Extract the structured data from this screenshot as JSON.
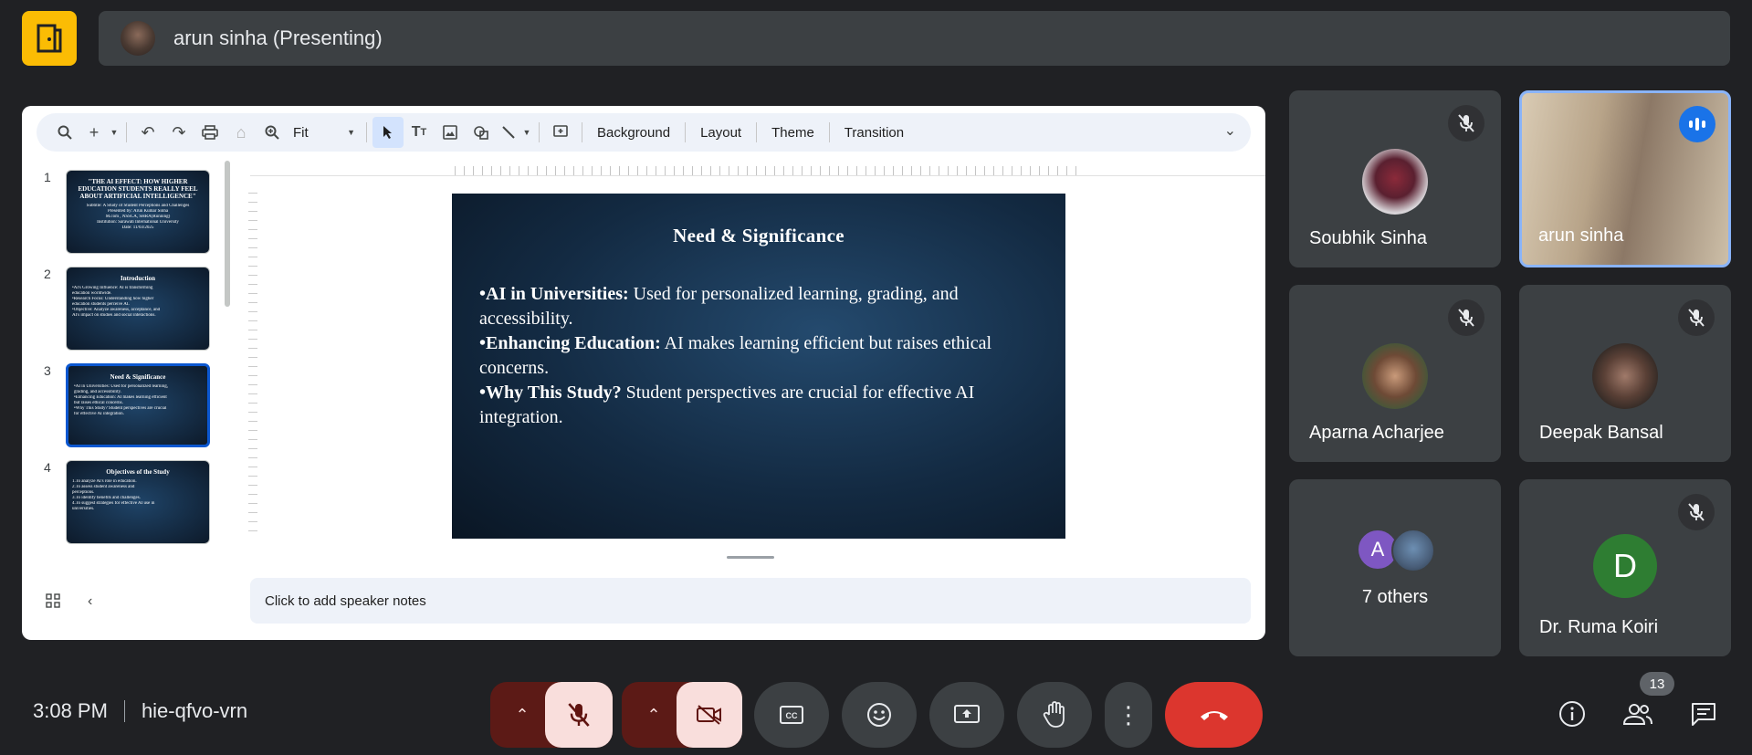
{
  "top": {
    "presenter_label": "arun sinha (Presenting)"
  },
  "toolbar": {
    "zoom_value": "Fit",
    "background_label": "Background",
    "layout_label": "Layout",
    "theme_label": "Theme",
    "transition_label": "Transition"
  },
  "filmstrip": {
    "slides": [
      {
        "number": "1",
        "title": "\"THE AI EFFECT: HOW HIGHER EDUCATION STUDENTS REALLY FEEL ABOUT ARTIFICIAL INTELLIGENCE\"",
        "lines": [
          "Subtitle: A Study of Student Perceptions and Challenges",
          "Presented by: Arun Kumar Sinha",
          "M.com , NSSCA, SHRA(Running)",
          "Institution: Sarawati International University",
          "Date: 11/03/2025"
        ]
      },
      {
        "number": "2",
        "title": "Introduction",
        "lines": [
          "•AI's Growing Influence: AI is transforming",
          "education worldwide.",
          "•Research Focus: Understanding how higher",
          "education students perceive AI.",
          "•Objective: Analyze awareness, acceptance, and",
          "AI's impact on studies and social interactions."
        ]
      },
      {
        "number": "3",
        "title": "Need & Significance",
        "lines": [
          "•AI in Universities: Used for personalized learning,",
          "grading, and accessibility.",
          "•Enhancing Education: AI makes learning efficient",
          "but raises ethical concerns.",
          "•Why This Study? Student perspectives are crucial",
          "for effective AI integration."
        ]
      },
      {
        "number": "4",
        "title": "Objectives of the Study",
        "lines": [
          "1.To analyze AI's role in education.",
          "2.To assess student awareness and",
          "perceptions.",
          "3.To identify benefits and challenges.",
          "4.To suggest strategies for effective AI use in",
          "universities."
        ]
      }
    ]
  },
  "slide": {
    "title": "Need & Significance",
    "bullets": [
      {
        "bold": "•AI in Universities:",
        "text": " Used for personalized learning, grading, and accessibility."
      },
      {
        "bold": "•Enhancing Education:",
        "text": " AI makes learning efficient but raises ethical concerns."
      },
      {
        "bold": "•Why This Study?",
        "text": " Student perspectives are crucial for effective AI integration."
      }
    ]
  },
  "notes": {
    "placeholder": "Click to add speaker notes"
  },
  "participants": {
    "soubhik": "Soubhik Sinha",
    "arun": "arun sinha",
    "aparna": "Aparna Acharjee",
    "deepak": "Deepak Bansal",
    "others_initial": "A",
    "others_label": "7 others",
    "ruma_initial": "D",
    "ruma": "Dr. Ruma Koiri"
  },
  "bottom": {
    "time": "3:08 PM",
    "meeting_code": "hie-qfvo-vrn",
    "participant_count": "13"
  },
  "colors": {
    "accent_yellow": "#fbbc04",
    "end_call_red": "#dc362e",
    "speaking_blue": "#1a73e8"
  }
}
